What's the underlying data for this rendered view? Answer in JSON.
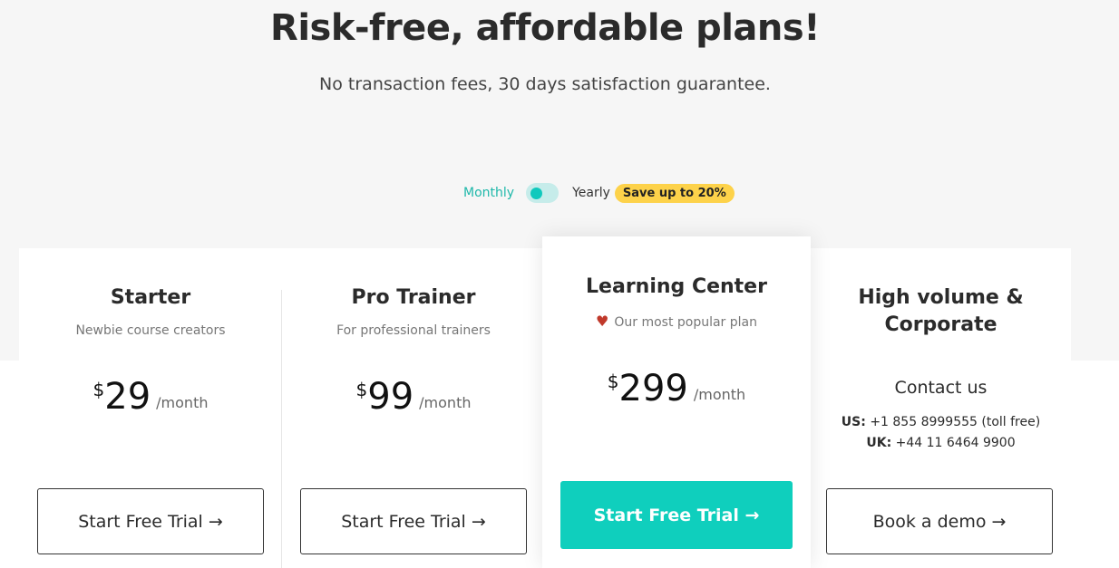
{
  "header": {
    "title": "Risk-free, affordable plans!",
    "subtitle": "No transaction fees, 30 days satisfaction guarantee."
  },
  "billing": {
    "monthly_label": "Monthly",
    "yearly_label": "Yearly",
    "save_badge": "Save up to 20%",
    "selected": "Monthly"
  },
  "plans": [
    {
      "title": "Starter",
      "subtitle": "Newbie course creators",
      "currency": "$",
      "price": "29",
      "period": "/month",
      "cta": "Start Free Trial →"
    },
    {
      "title": "Pro Trainer",
      "subtitle": "For professional trainers",
      "currency": "$",
      "price": "99",
      "period": "/month",
      "cta": "Start Free Trial →"
    },
    {
      "title": "Learning Center",
      "subtitle": "Our most popular plan",
      "currency": "$",
      "price": "299",
      "period": "/month",
      "cta": "Start Free Trial →"
    },
    {
      "title_line1": "High volume &",
      "title_line2": "Corporate",
      "contact_title": "Contact us",
      "us_label": "US:",
      "us_phone": "+1 855 8999555 (toll free)",
      "uk_label": "UK:",
      "uk_phone": "+44 11 6464 9900",
      "cta": "Book a demo →"
    }
  ],
  "colors": {
    "accent": "#0fcfbd",
    "badge": "#fdd24a",
    "heart": "#c0392b"
  },
  "icons": {
    "popular": "heart-icon"
  }
}
